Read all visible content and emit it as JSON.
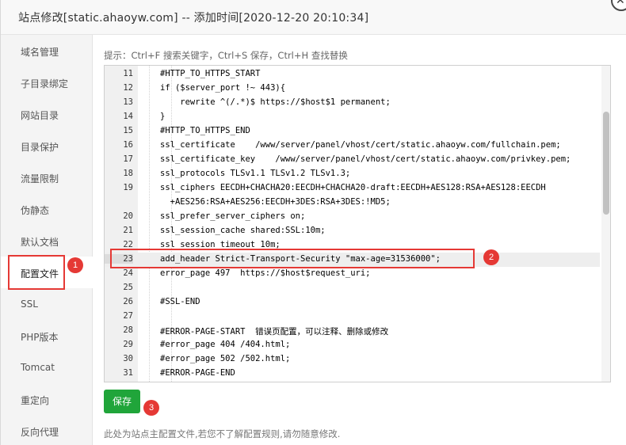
{
  "dialog": {
    "title": "站点修改[static.ahaoyw.com] -- 添加时间[2020-12-20 20:10:34]",
    "close_glyph": "✕"
  },
  "sidebar": {
    "items": [
      {
        "label": "域名管理"
      },
      {
        "label": "子目录绑定"
      },
      {
        "label": "网站目录"
      },
      {
        "label": "目录保护"
      },
      {
        "label": "流量限制"
      },
      {
        "label": "伪静态"
      },
      {
        "label": "默认文档"
      },
      {
        "label": "配置文件",
        "active": true
      },
      {
        "label": "SSL"
      },
      {
        "label": "PHP版本"
      },
      {
        "label": "Tomcat"
      },
      {
        "label": "重定向"
      },
      {
        "label": "反向代理"
      }
    ]
  },
  "editor": {
    "tip": "提示：Ctrl+F 搜索关键字，Ctrl+S 保存，Ctrl+H 查找替换",
    "lines": [
      {
        "num": "11",
        "code": "#HTTP_TO_HTTPS_START"
      },
      {
        "num": "12",
        "code": "if ($server_port !~ 443){"
      },
      {
        "num": "13",
        "code": "    rewrite ^(/.*)$ https://$host$1 permanent;"
      },
      {
        "num": "14",
        "code": "}"
      },
      {
        "num": "15",
        "code": "#HTTP_TO_HTTPS_END"
      },
      {
        "num": "16",
        "code": "ssl_certificate    /www/server/panel/vhost/cert/static.ahaoyw.com/fullchain.pem;"
      },
      {
        "num": "17",
        "code": "ssl_certificate_key    /www/server/panel/vhost/cert/static.ahaoyw.com/privkey.pem;"
      },
      {
        "num": "18",
        "code": "ssl_protocols TLSv1.1 TLSv1.2 TLSv1.3;"
      },
      {
        "num": "19",
        "code": "ssl_ciphers EECDH+CHACHA20:EECDH+CHACHA20-draft:EECDH+AES128:RSA+AES128:EECDH"
      },
      {
        "num": "",
        "code": "  +AES256:RSA+AES256:EECDH+3DES:RSA+3DES:!MD5;"
      },
      {
        "num": "20",
        "code": "ssl_prefer_server_ciphers on;"
      },
      {
        "num": "21",
        "code": "ssl_session_cache shared:SSL:10m;"
      },
      {
        "num": "22",
        "code": "ssl_session_timeout 10m;"
      },
      {
        "num": "23",
        "code": "add_header Strict-Transport-Security \"max-age=31536000\";",
        "highlight": true
      },
      {
        "num": "24",
        "code": "error_page 497  https://$host$request_uri;"
      },
      {
        "num": "25",
        "code": ""
      },
      {
        "num": "26",
        "code": "#SSL-END"
      },
      {
        "num": "27",
        "code": ""
      },
      {
        "num": "28",
        "code": "#ERROR-PAGE-START  错误页配置，可以注释、删除或修改"
      },
      {
        "num": "29",
        "code": "#error_page 404 /404.html;"
      },
      {
        "num": "30",
        "code": "#error_page 502 /502.html;"
      },
      {
        "num": "31",
        "code": "#ERROR-PAGE-END"
      }
    ]
  },
  "actions": {
    "save_label": "保存",
    "note": "此处为站点主配置文件,若您不了解配置规则,请勿随意修改."
  },
  "annotations": {
    "badge1": "1",
    "badge2": "2",
    "badge3": "3"
  },
  "colors": {
    "accent_green": "#20a53a",
    "callout_red": "#e53935"
  }
}
